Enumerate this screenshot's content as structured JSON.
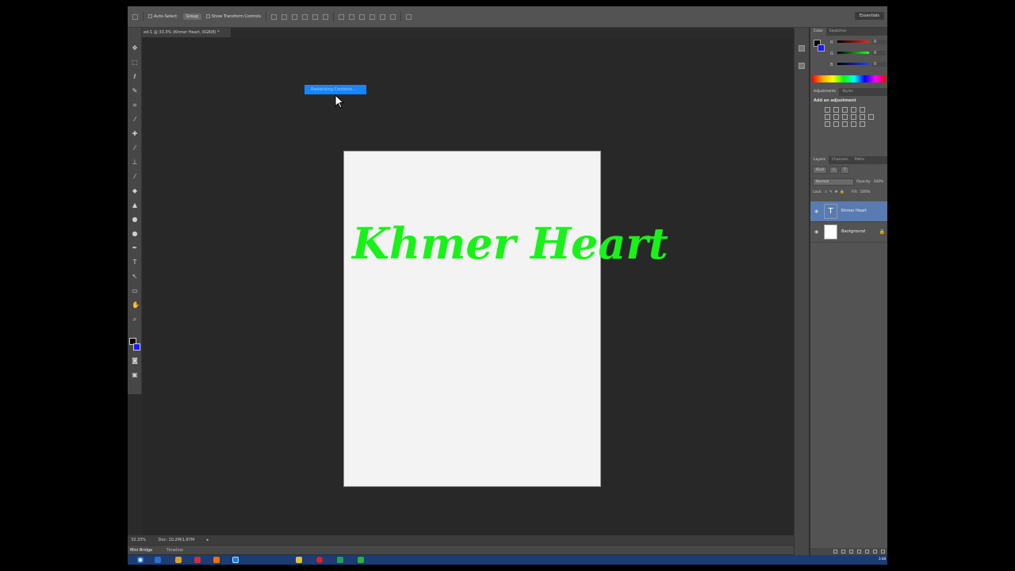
{
  "options_bar": {
    "auto_select_label": "Auto-Select:",
    "auto_select_value": "Group",
    "show_transform_label": "Show Transform Controls",
    "workspace": "Essentials"
  },
  "document": {
    "tab_title": "ed-1 @ 33.3% (Khmer Heart, RGB/8) *",
    "text": "Khmer Heart",
    "text_color": "#19f219",
    "background_color": "#f3f3f3"
  },
  "popup": {
    "label": "Rasterizing Contents..."
  },
  "status_bar": {
    "zoom": "33.33%",
    "doc_info": "Doc: 10.2M/1.87M"
  },
  "bottom_tabs": {
    "mini_bridge": "Mini Bridge",
    "timeline": "Timeline"
  },
  "color_panel": {
    "tabs": [
      "Color",
      "Swatches"
    ],
    "channels": [
      {
        "label": "R",
        "value": "0",
        "color": "#ff2020"
      },
      {
        "label": "G",
        "value": "0",
        "color": "#20ff20"
      },
      {
        "label": "B",
        "value": "0",
        "color": "#2040ff"
      }
    ]
  },
  "adjustments_panel": {
    "tabs": [
      "Adjustments",
      "Styles"
    ],
    "title": "Add an adjustment"
  },
  "layers_panel": {
    "tabs": [
      "Layers",
      "Channels",
      "Paths"
    ],
    "kind_filter": "Kind",
    "blend_mode": "Normal",
    "opacity_label": "Opacity:",
    "opacity_value": "100%",
    "lock_label": "Lock:",
    "fill_label": "Fill:",
    "fill_value": "100%",
    "layers": [
      {
        "name": "Khmer Heart",
        "type": "text"
      },
      {
        "name": "Background",
        "type": "image"
      }
    ]
  },
  "taskbar": {
    "clock": "3:48"
  }
}
